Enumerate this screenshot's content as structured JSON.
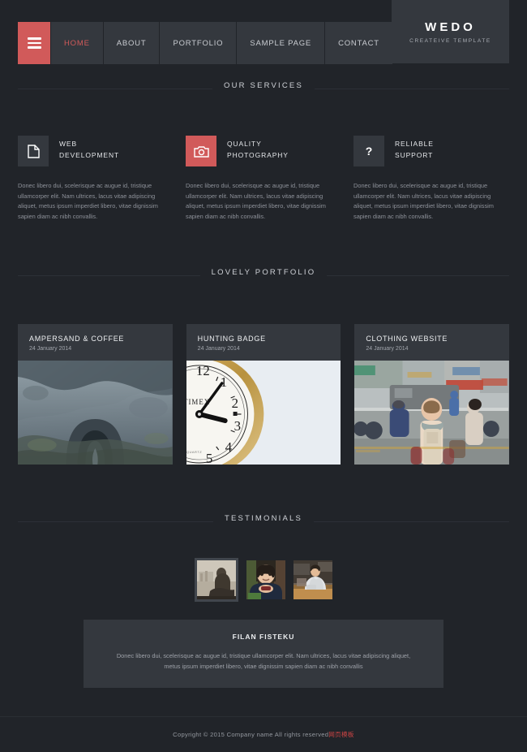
{
  "header": {
    "menu_icon": "hamburger-icon",
    "nav": [
      {
        "label": "HOME",
        "active": true
      },
      {
        "label": "ABOUT",
        "active": false
      },
      {
        "label": "PORTFOLIO",
        "active": false
      },
      {
        "label": "SAMPLE PAGE",
        "active": false
      },
      {
        "label": "CONTACT",
        "active": false
      }
    ],
    "logo": {
      "title": "WEDO",
      "subtitle": "CREATEIVE TEMPLATE"
    }
  },
  "services": {
    "heading": "OUR SERVICES",
    "items": [
      {
        "icon": "document-icon",
        "accent": false,
        "title": "WEB\nDEVELOPMENT",
        "title_line1": "WEB",
        "title_line2": "DEVELOPMENT",
        "body": "Donec libero dui, scelerisque ac augue id, tristique ullamcorper elit. Nam ultrices, lacus vitae adipiscing aliquet, metus ipsum imperdiet libero, vitae dignissim sapien diam ac nibh convallis."
      },
      {
        "icon": "camera-icon",
        "accent": true,
        "title_line1": "QUALITY",
        "title_line2": "PHOTOGRAPHY",
        "body": "Donec libero dui, scelerisque ac augue id, tristique ullamcorper elit. Nam ultrices, lacus vitae adipiscing aliquet, metus ipsum imperdiet libero, vitae dignissim sapien diam ac nibh convallis."
      },
      {
        "icon": "question-mark-icon",
        "accent": false,
        "title_line1": "RELIABLE",
        "title_line2": "SUPPORT",
        "body": "Donec libero dui, scelerisque ac augue id, tristique ullamcorper elit. Nam ultrices, lacus vitae adipiscing aliquet, metus ipsum imperdiet libero, vitae dignissim sapien diam ac nibh convallis."
      }
    ]
  },
  "portfolio": {
    "heading": "LOVELY PORTFOLIO",
    "items": [
      {
        "title": "AMPERSAND & COFFEE",
        "date": "24 January 2014",
        "image": "rock-arch-landscape-photo"
      },
      {
        "title": "HUNTING BADGE",
        "date": "24 January 2014",
        "image": "timex-clock-face-photo"
      },
      {
        "title": "CLOTHING WEBSITE",
        "date": "24 January 2014",
        "image": "street-backpacker-photo"
      }
    ]
  },
  "testimonials": {
    "heading": "TESTIMONIALS",
    "thumbnails": [
      {
        "image": "sepia-man-sitting-photo",
        "selected": true
      },
      {
        "image": "woman-smiling-photo",
        "selected": false
      },
      {
        "image": "man-at-desk-photo",
        "selected": false
      }
    ],
    "quote": {
      "name": "FILAN FISTEKU",
      "text": "Donec libero dui, scelerisque ac augue id, tristique ullamcorper elit. Nam ultrices, lacus vitae adipiscing aliquet, metus ipsum imperdiet libero, vitae dignissim sapien diam ac nibh convallis"
    }
  },
  "footer": {
    "copyright": "Copyright © 2015 Company name All rights reserved",
    "link": "网页模板"
  },
  "colors": {
    "background": "#212429",
    "panel": "#34383e",
    "accent": "#d15a5a",
    "link": "#cc4444"
  }
}
